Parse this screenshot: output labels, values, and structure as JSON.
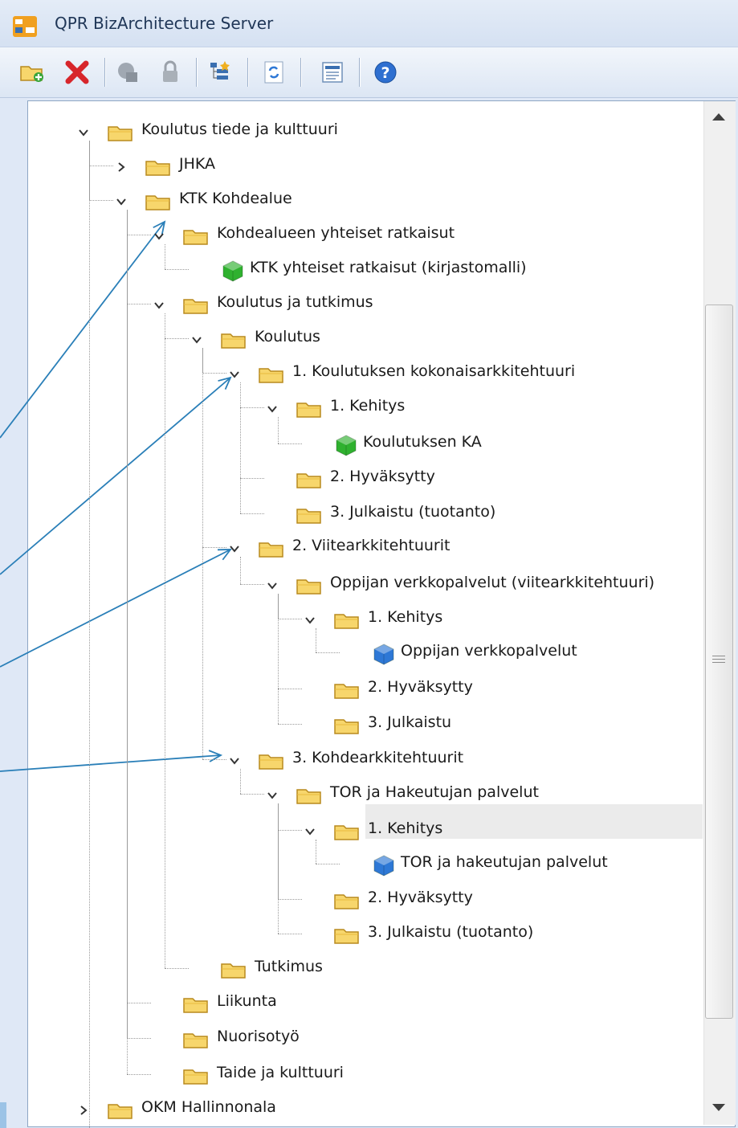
{
  "window": {
    "title": "QPR BizArchitecture Server"
  },
  "toolbar": {
    "buttons": [
      {
        "name": "add-folder",
        "icon": "add-folder-icon"
      },
      {
        "name": "delete",
        "icon": "delete-icon"
      },
      {
        "name": "check-out",
        "icon": "check-out-icon"
      },
      {
        "name": "lock",
        "icon": "lock-icon"
      },
      {
        "name": "properties",
        "icon": "properties-tree-icon"
      },
      {
        "name": "refresh",
        "icon": "refresh-icon"
      },
      {
        "name": "view",
        "icon": "view-icon"
      },
      {
        "name": "help",
        "icon": "help-icon"
      }
    ]
  },
  "tree": {
    "nodes": [
      {
        "label": "Koulutus tiede ja kulttuuri",
        "type": "folder",
        "expanded": true
      },
      {
        "label": "JHKA",
        "type": "folder",
        "expanded": false
      },
      {
        "label": "KTK Kohdealue",
        "type": "folder",
        "expanded": true
      },
      {
        "label": "Kohdealueen yhteiset ratkaisut",
        "type": "folder",
        "expanded": true
      },
      {
        "label": "KTK yhteiset ratkaisut (kirjastomalli)",
        "type": "model-green"
      },
      {
        "label": "Koulutus ja tutkimus",
        "type": "folder",
        "expanded": true
      },
      {
        "label": "Koulutus",
        "type": "folder",
        "expanded": true
      },
      {
        "label": "1. Koulutuksen kokonaisarkkitehtuuri",
        "type": "folder",
        "expanded": true
      },
      {
        "label": "1. Kehitys",
        "type": "folder",
        "expanded": true
      },
      {
        "label": "Koulutuksen KA",
        "type": "model-green"
      },
      {
        "label": "2. Hyväksytty",
        "type": "folder"
      },
      {
        "label": "3. Julkaistu (tuotanto)",
        "type": "folder"
      },
      {
        "label": "2. Viitearkkitehtuurit",
        "type": "folder",
        "expanded": true
      },
      {
        "label": "Oppijan verkkopalvelut (viitearkkitehtuuri)",
        "type": "folder",
        "expanded": true
      },
      {
        "label": "1. Kehitys",
        "type": "folder",
        "expanded": true
      },
      {
        "label": "Oppijan verkkopalvelut",
        "type": "model-blue"
      },
      {
        "label": "2. Hyväksytty",
        "type": "folder"
      },
      {
        "label": "3. Julkaistu",
        "type": "folder"
      },
      {
        "label": "3. Kohdearkkitehtuurit",
        "type": "folder",
        "expanded": true
      },
      {
        "label": "TOR ja Hakeutujan palvelut",
        "type": "folder",
        "expanded": true
      },
      {
        "label": "1. Kehitys",
        "type": "folder",
        "expanded": true,
        "selected": true
      },
      {
        "label": "TOR ja hakeutujan palvelut",
        "type": "model-blue"
      },
      {
        "label": "2. Hyväksytty",
        "type": "folder"
      },
      {
        "label": "3. Julkaistu (tuotanto)",
        "type": "folder"
      },
      {
        "label": "Tutkimus",
        "type": "folder"
      },
      {
        "label": "Liikunta",
        "type": "folder"
      },
      {
        "label": "Nuorisotyö",
        "type": "folder"
      },
      {
        "label": "Taide ja kulttuuri",
        "type": "folder"
      },
      {
        "label": "OKM Hallinnonala",
        "type": "folder",
        "expanded": false
      }
    ]
  },
  "colors": {
    "folder_fill": "#f7d66c",
    "folder_stroke": "#b88a1e",
    "model_green": "#2fb12f",
    "model_blue": "#2e78d6",
    "annotation_arrow": "#2a7fb8",
    "selection": "#ebebeb"
  }
}
